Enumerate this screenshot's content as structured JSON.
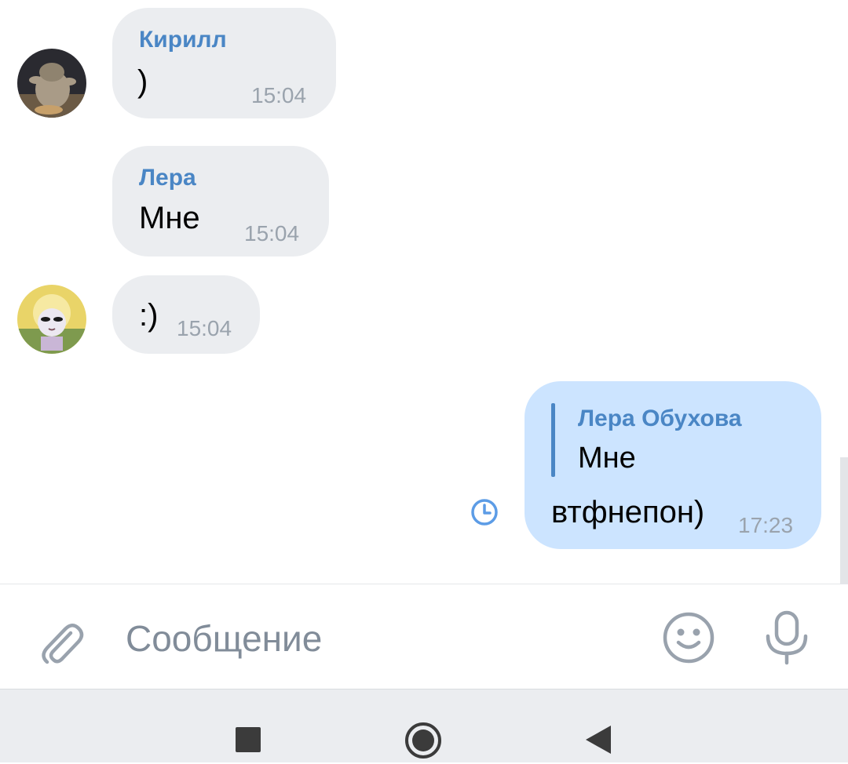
{
  "messages": [
    {
      "sender": "Кирилл",
      "text": ")",
      "time": "15:04"
    },
    {
      "sender": "Лера",
      "text": "Мне",
      "time": "15:04"
    },
    {
      "text": ":)",
      "time": "15:04"
    },
    {
      "quote_sender": "Лера Обухова",
      "quote_text": "Мне",
      "text": "втфнепон)",
      "time": "17:23",
      "status": "clock-icon"
    }
  ],
  "composer": {
    "placeholder": "Сообщение"
  },
  "colors": {
    "accent": "#4a86c5",
    "incoming_bubble": "#ebedf0",
    "outgoing_bubble": "#cce4ff"
  }
}
